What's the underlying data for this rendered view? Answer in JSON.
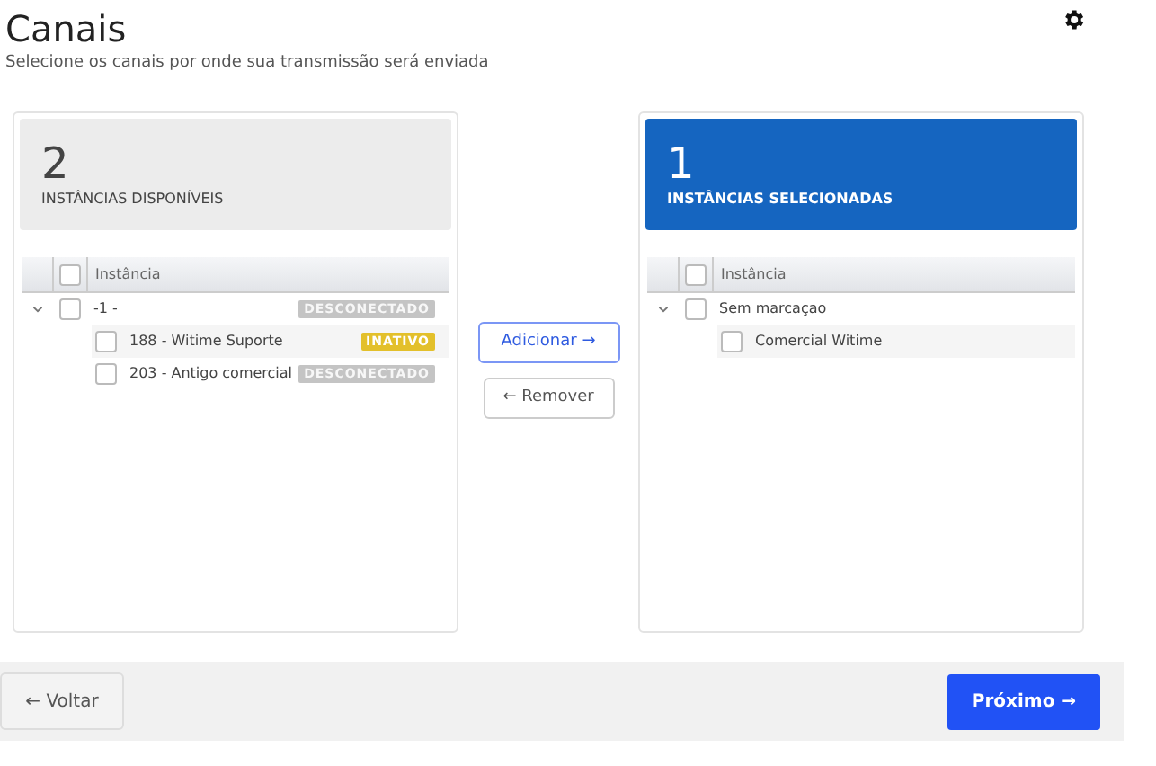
{
  "header": {
    "title": "Canais",
    "subtitle": "Selecione os canais por onde sua transmissão será enviada"
  },
  "panels": [
    {
      "kind": "available",
      "count": "2",
      "caption": "INSTÂNCIAS DISPONÍVEIS",
      "column": "Instância",
      "checked": false,
      "rows": [
        {
          "label": "-1 -",
          "checked": false,
          "expanded": true,
          "badge": {
            "text": "DESCONECTADO",
            "kind": "disconnected"
          },
          "children": [
            {
              "label": "188 - Witime Suporte",
              "checked": false,
              "badge": {
                "text": "INATIVO",
                "kind": "inactive"
              }
            },
            {
              "label": "203 - Antigo comercial",
              "checked": false,
              "badge": {
                "text": "DESCONECTADO",
                "kind": "disconnected"
              }
            }
          ]
        }
      ]
    },
    {
      "kind": "selected",
      "count": "1",
      "caption": "INSTÂNCIAS SELECIONADAS",
      "column": "Instância",
      "checked": false,
      "rows": [
        {
          "label": "Sem marcaçao",
          "checked": false,
          "expanded": true,
          "children": [
            {
              "label": "Comercial Witime",
              "checked": false
            }
          ]
        }
      ]
    }
  ],
  "transfer": {
    "add": "Adicionar →",
    "remove": "← Remover"
  },
  "footer": {
    "back": "← Voltar",
    "next": "Próximo →"
  }
}
